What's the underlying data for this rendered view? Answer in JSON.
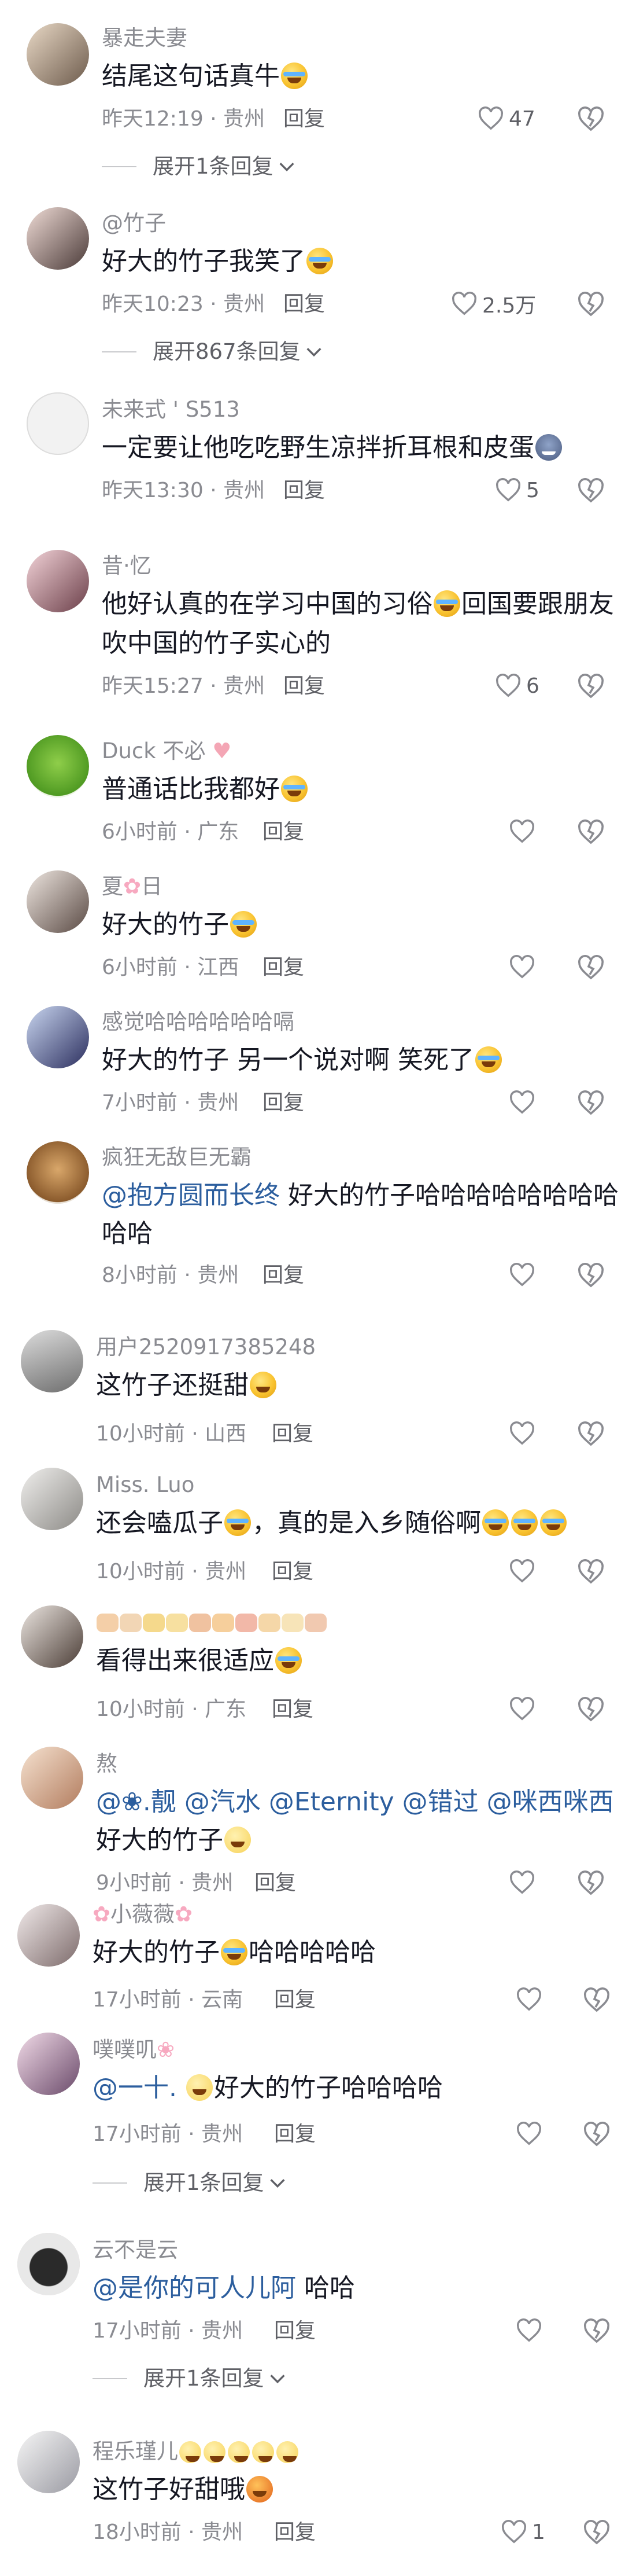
{
  "comments": [
    {
      "user": "暴走夫妻",
      "text": "结尾这句话真牛",
      "time": "昨天12:19 · 贵州",
      "reply": "回复",
      "likes": "47",
      "expand": "展开1条回复"
    },
    {
      "user": "@竹子",
      "text": "好大的竹子我笑了",
      "time": "昨天10:23 · 贵州",
      "reply": "回复",
      "likes": "2.5万",
      "expand": "展开867条回复"
    },
    {
      "user": "未来式 ' S513",
      "text": "一定要让他吃吃野生凉拌折耳根和皮蛋",
      "time": "昨天13:30 · 贵州",
      "reply": "回复",
      "likes": "5"
    },
    {
      "user": "昔·忆",
      "text": "他好认真的在学习中国的习俗",
      "text2": "回国要跟朋友",
      "text3": "吹中国的竹子实心的",
      "time": "昨天15:27 · 贵州",
      "reply": "回复",
      "likes": "6"
    },
    {
      "user": "Duck 不必",
      "text": "普通话比我都好",
      "time": "6小时前 · 广东",
      "reply": "回复"
    },
    {
      "user": "夏",
      "user2": "日",
      "text": "好大的竹子",
      "time": "6小时前 · 江西",
      "reply": "回复"
    },
    {
      "user": "感觉哈哈哈哈哈哈嗝",
      "text": "好大的竹子 另一个说对啊 笑死了",
      "time": "7小时前 · 贵州",
      "reply": "回复"
    },
    {
      "user": "疯狂无敌巨无霸",
      "mention": "@抱方圆而长终",
      "text": " 好大的竹子哈哈哈哈哈哈哈哈",
      "text2": "哈哈",
      "time": "8小时前 · 贵州",
      "reply": "回复"
    },
    {
      "user": "用户2520917385248",
      "text": "这竹子还挺甜",
      "time": "10小时前 · 山西",
      "reply": "回复"
    },
    {
      "user": "Miss. Luo",
      "text": "还会嗑瓜子",
      "text2": "，真的是入乡随俗啊",
      "time": "10小时前 · 贵州",
      "reply": "回复"
    },
    {
      "user": "",
      "text": "看得出来很适应",
      "time": "10小时前 · 广东",
      "reply": "回复"
    },
    {
      "user": "熬",
      "mention": "@❀.靓 @汽水 @Eternity @错过 @咪西咪西",
      "text": "好大的竹子",
      "time": "9小时前 · 贵州",
      "reply": "回复"
    },
    {
      "user": "小薇薇",
      "text": "好大的竹子",
      "text2": "哈哈哈哈哈",
      "time": "17小时前 · 云南",
      "reply": "回复"
    },
    {
      "user": "噗噗叽",
      "mention": "@一十.",
      "text": "好大的竹子哈哈哈哈",
      "time": "17小时前 · 贵州",
      "reply": "回复",
      "expand": "展开1条回复"
    },
    {
      "user": "云不是云",
      "mention": "@是你的可人儿阿",
      "text": " 哈哈",
      "time": "17小时前 · 贵州",
      "reply": "回复",
      "expand": "展开1条回复"
    },
    {
      "user": "程乐瑾儿",
      "text": "这竹子好甜哦",
      "time": "18小时前 · 贵州",
      "reply": "回复",
      "likes": "1"
    }
  ],
  "colors": {
    "text": "#161823",
    "muted": "#8a8b91",
    "link": "#2c5e9e",
    "bg": "#ffffff"
  }
}
